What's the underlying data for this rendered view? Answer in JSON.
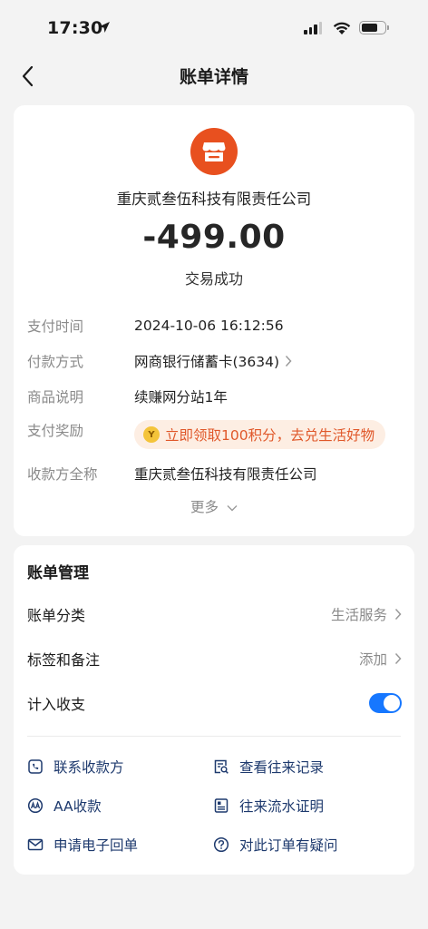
{
  "status_bar": {
    "time": "17:30"
  },
  "nav": {
    "title": "账单详情"
  },
  "bill": {
    "merchant_icon": "storefront-icon",
    "merchant_name": "重庆贰叁伍科技有限责任公司",
    "amount": "-499.00",
    "status": "交易成功",
    "details": [
      {
        "label": "支付时间",
        "value": "2024-10-06 16:12:56"
      },
      {
        "label": "付款方式",
        "value": "网商银行储蓄卡(3634)"
      },
      {
        "label": "商品说明",
        "value": "续赚网分站1年"
      },
      {
        "label": "支付奖励",
        "value": "立即领取100积分，去兑生活好物"
      },
      {
        "label": "收款方全称",
        "value": "重庆贰叁伍科技有限责任公司"
      }
    ],
    "more_label": "更多"
  },
  "management": {
    "title": "账单管理",
    "category_label": "账单分类",
    "category_value": "生活服务",
    "tags_label": "标签和备注",
    "tags_value": "添加",
    "include_label": "计入收支",
    "include_enabled": true,
    "actions": [
      {
        "label": "联系收款方",
        "icon": "phone-chat-icon"
      },
      {
        "label": "查看往来记录",
        "icon": "records-search-icon"
      },
      {
        "label": "AA收款",
        "icon": "aa-icon"
      },
      {
        "label": "往来流水证明",
        "icon": "statement-icon"
      },
      {
        "label": "申请电子回单",
        "icon": "mail-icon"
      },
      {
        "label": "对此订单有疑问",
        "icon": "question-icon"
      }
    ]
  },
  "colors": {
    "accent": "#1677ff",
    "merchant": "#e8501f",
    "reward": "#e0582a",
    "link": "#1e3a6e"
  }
}
